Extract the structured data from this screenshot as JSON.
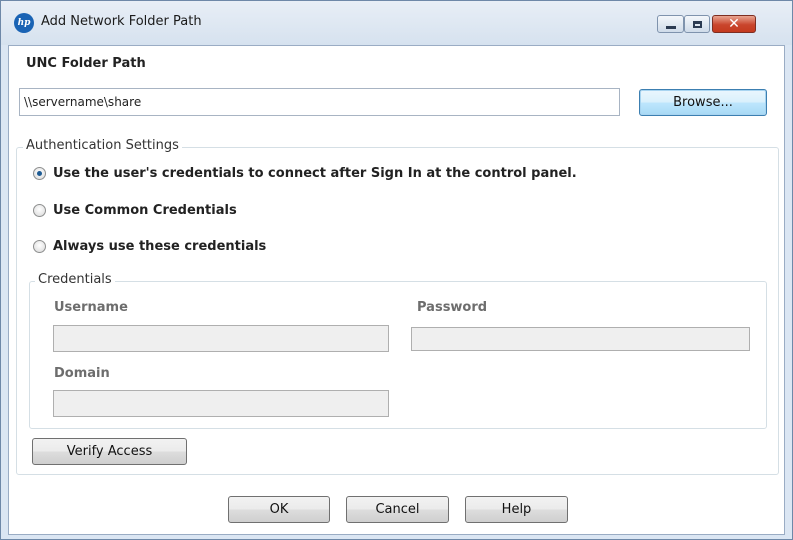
{
  "window": {
    "title": "Add Network Folder Path",
    "logo_text": "hp",
    "minimize_icon": "minimize-icon",
    "maximize_icon": "maximize-icon",
    "close_icon": "close-icon"
  },
  "unc": {
    "label": "UNC Folder Path",
    "value": "\\\\servername\\share",
    "browse_label": "Browse..."
  },
  "auth": {
    "legend": "Authentication Settings",
    "options": [
      {
        "label": "Use the user's credentials to connect after Sign In at the control panel.",
        "selected": true
      },
      {
        "label": "Use Common Credentials",
        "selected": false
      },
      {
        "label": "Always use these credentials",
        "selected": false
      }
    ],
    "credentials": {
      "legend": "Credentials",
      "username_label": "Username",
      "password_label": "Password",
      "domain_label": "Domain",
      "username_value": "",
      "password_value": "",
      "domain_value": ""
    },
    "verify_label": "Verify Access"
  },
  "footer": {
    "ok_label": "OK",
    "cancel_label": "Cancel",
    "help_label": "Help"
  },
  "colors": {
    "selected_radio": "#1e5b93",
    "close_button": "#c9452c",
    "window_frame": "#dbe6f3"
  }
}
